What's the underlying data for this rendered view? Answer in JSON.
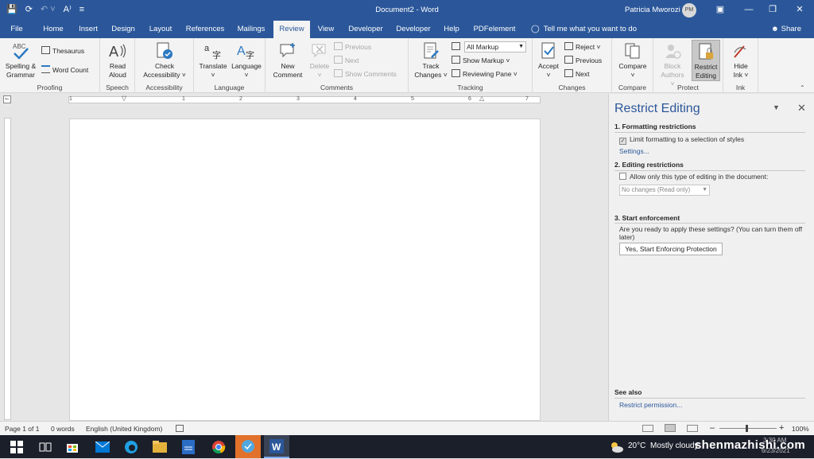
{
  "title_bar": {
    "document_title": "Document2 - Word",
    "user_name": "Patricia Mworozi",
    "user_initials": "PM",
    "autosave_label": "A⁾"
  },
  "tabs": [
    "File",
    "Home",
    "Insert",
    "Design",
    "Layout",
    "References",
    "Mailings",
    "Review",
    "View",
    "Developer",
    "Developer",
    "Help",
    "PDFelement"
  ],
  "active_tab": "Review",
  "tell_me": "Tell me what you want to do",
  "share": "Share",
  "ribbon": {
    "proofing": {
      "label": "Proofing",
      "spelling_1": "Spelling &",
      "spelling_2": "Grammar",
      "thesaurus": "Thesaurus",
      "word_count": "Word Count"
    },
    "speech": {
      "label": "Speech",
      "read_1": "Read",
      "read_2": "Aloud"
    },
    "accessibility": {
      "label": "Accessibility",
      "check_1": "Check",
      "check_2": "Accessibility ˅"
    },
    "language": {
      "label": "Language",
      "translate": "Translate",
      "language": "Language"
    },
    "comments": {
      "label": "Comments",
      "new_1": "New",
      "new_2": "Comment",
      "delete": "Delete",
      "previous": "Previous",
      "next": "Next",
      "show": "Show Comments"
    },
    "tracking": {
      "label": "Tracking",
      "track_1": "Track",
      "track_2": "Changes ˅",
      "markup": "All Markup",
      "show_markup": "Show Markup ˅",
      "reviewing_pane": "Reviewing Pane ˅"
    },
    "changes": {
      "label": "Changes",
      "accept": "Accept",
      "reject": "Reject ˅",
      "previous": "Previous",
      "next": "Next"
    },
    "compare": {
      "label": "Compare",
      "compare": "Compare"
    },
    "protect": {
      "label": "Protect",
      "block_1": "Block",
      "block_2": "Authors ˅",
      "restrict_1": "Restrict",
      "restrict_2": "Editing"
    },
    "ink": {
      "label": "Ink",
      "hide_1": "Hide",
      "hide_2": "Ink ˅"
    }
  },
  "ruler_numbers": [
    "1",
    "1",
    "2",
    "3",
    "4",
    "5",
    "6",
    "7"
  ],
  "pane": {
    "title": "Restrict Editing",
    "section1_title": "1. Formatting restrictions",
    "section1_check": "Limit formatting to a selection of styles",
    "section1_link": "Settings...",
    "section2_title": "2. Editing restrictions",
    "section2_check": "Allow only this type of editing in the document:",
    "section2_select": "No changes (Read only)",
    "section3_title": "3. Start enforcement",
    "section3_text_1": "Are you ready to apply these settings? (You can turn them off",
    "section3_text_2": "later)",
    "section3_button": "Yes, Start Enforcing Protection",
    "see_also": "See also",
    "see_also_link": "Restrict permission..."
  },
  "status_bar": {
    "page": "Page 1 of 1",
    "words": "0 words",
    "language": "English (United Kingdom)",
    "zoom": "100%"
  },
  "taskbar": {
    "temperature": "20°C",
    "weather": "Mostly cloudy",
    "time": "3:30 AM",
    "date": "6/23/2021"
  },
  "watermark": "shenmazhishi.com",
  "colors": {
    "brand": "#2b579a",
    "taskbar": "#1b1f2a",
    "ribbon": "#f3f3f3"
  }
}
